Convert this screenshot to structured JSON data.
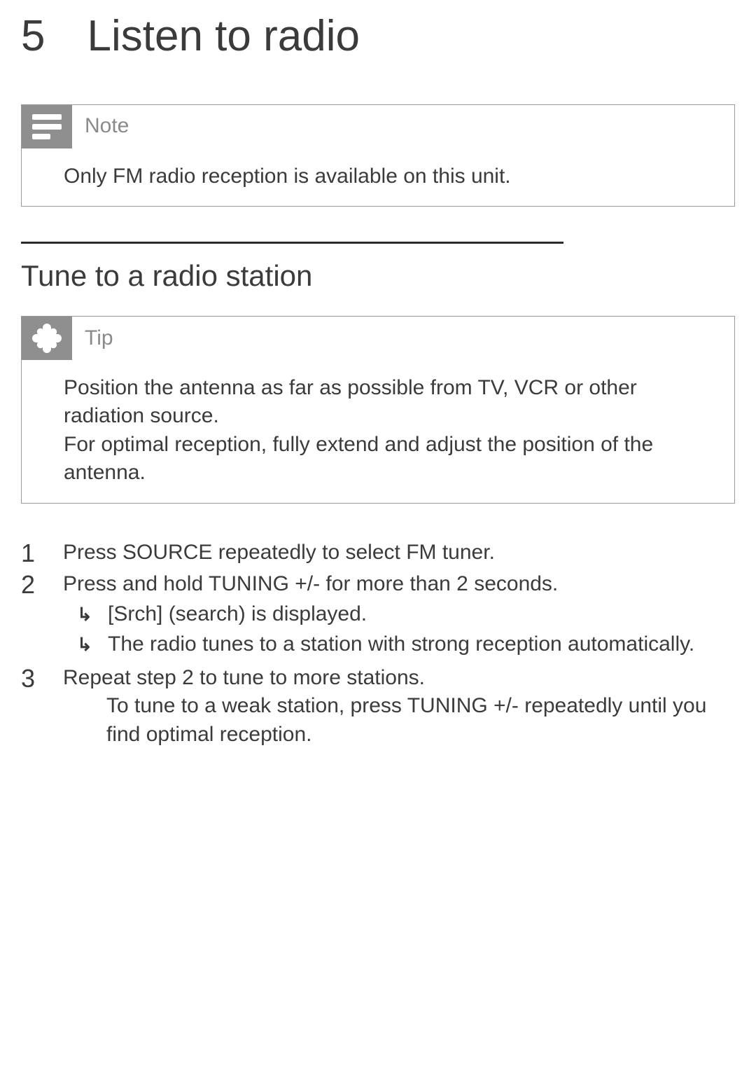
{
  "chapter": {
    "number": "5",
    "title": "Listen to radio"
  },
  "note": {
    "label": "Note",
    "body": "Only FM radio reception is available on this unit."
  },
  "section": {
    "title": "Tune to a radio station"
  },
  "tip": {
    "label": "Tip",
    "body": "Position the antenna as far as possible from TV, VCR or other radiation source.\nFor optimal reception, fully extend and adjust the position of the antenna."
  },
  "steps": {
    "s1": {
      "num": "1",
      "text": "Press SOURCE repeatedly to select FM tuner."
    },
    "s2": {
      "num": "2",
      "text": "Press and hold TUNING +/- for more than 2 seconds.",
      "sub1": "[Srch] (search) is displayed.",
      "sub2": "The radio tunes to a station with strong reception automatically."
    },
    "s3": {
      "num": "3",
      "text": "Repeat step 2 to tune to more stations.",
      "subtext": "To tune to a weak station, press TUNING +/- repeatedly until you ﬁnd optimal reception."
    }
  }
}
